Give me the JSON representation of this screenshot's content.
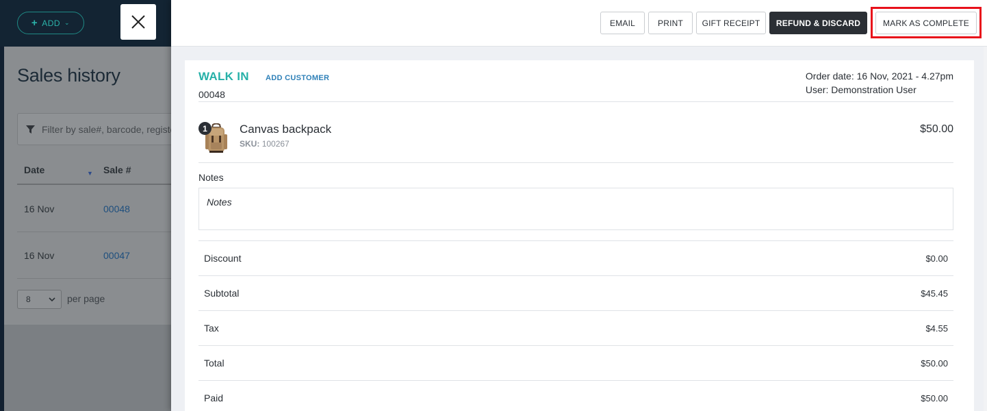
{
  "background": {
    "add_button": "ADD",
    "page_title": "Sales history",
    "filter_placeholder": "Filter by sale#, barcode, register",
    "columns": [
      "Date",
      "Sale #"
    ],
    "rows": [
      {
        "date": "16 Nov",
        "sale": "00048"
      },
      {
        "date": "16 Nov",
        "sale": "00047"
      }
    ],
    "per_page_value": "8",
    "per_page_label": "per page"
  },
  "toolbar": {
    "email": "EMAIL",
    "print": "PRINT",
    "gift_receipt": "GIFT RECEIPT",
    "refund_discard": "REFUND & DISCARD",
    "mark_complete": "MARK AS COMPLETE"
  },
  "order": {
    "customer": "WALK IN",
    "add_customer": "ADD CUSTOMER",
    "number": "00048",
    "order_date": "Order date: 16 Nov, 2021 - 4.27pm",
    "user": "User: Demonstration User"
  },
  "items": [
    {
      "qty": "1",
      "name": "Canvas backpack",
      "sku_label": "SKU:",
      "sku": "100267",
      "price": "$50.00"
    }
  ],
  "notes": {
    "label": "Notes",
    "placeholder": "Notes"
  },
  "totals": [
    {
      "label": "Discount",
      "value": "$0.00"
    },
    {
      "label": "Subtotal",
      "value": "$45.45"
    },
    {
      "label": "Tax",
      "value": "$4.55"
    },
    {
      "label": "Total",
      "value": "$50.00"
    },
    {
      "label": "Paid",
      "value": "$50.00"
    }
  ],
  "colors": {
    "accent_teal": "#26b0a8",
    "link_blue": "#2e80b8",
    "dark_button": "#2b2f35",
    "highlight_red": "#e8101a"
  }
}
